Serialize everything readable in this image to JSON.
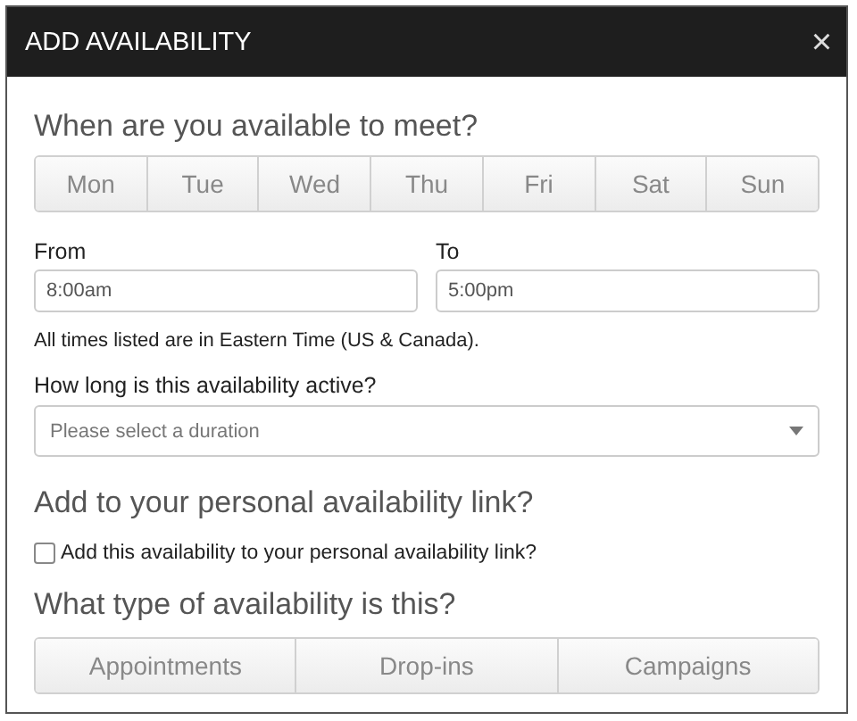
{
  "dialog": {
    "title": "ADD AVAILABILITY",
    "close": "×"
  },
  "days_heading": "When are you available to meet?",
  "days": [
    {
      "label": "Mon",
      "selected": false
    },
    {
      "label": "Tue",
      "selected": false
    },
    {
      "label": "Wed",
      "selected": false
    },
    {
      "label": "Thu",
      "selected": false
    },
    {
      "label": "Fri",
      "selected": false
    },
    {
      "label": "Sat",
      "selected": false
    },
    {
      "label": "Sun",
      "selected": false
    }
  ],
  "from": {
    "label": "From",
    "value": "8:00am"
  },
  "to": {
    "label": "To",
    "value": "5:00pm"
  },
  "timezone_note": "All times listed are in Eastern Time (US & Canada).",
  "duration": {
    "label": "How long is this availability active?",
    "placeholder": "Please select a duration"
  },
  "link_heading": "Add to your personal availability link?",
  "link_checkbox": {
    "label": "Add this availability to your personal availability link?",
    "checked": false
  },
  "type_heading": "What type of availability is this?",
  "types": [
    {
      "label": "Appointments",
      "selected": false
    },
    {
      "label": "Drop-ins",
      "selected": false
    },
    {
      "label": "Campaigns",
      "selected": false
    }
  ]
}
